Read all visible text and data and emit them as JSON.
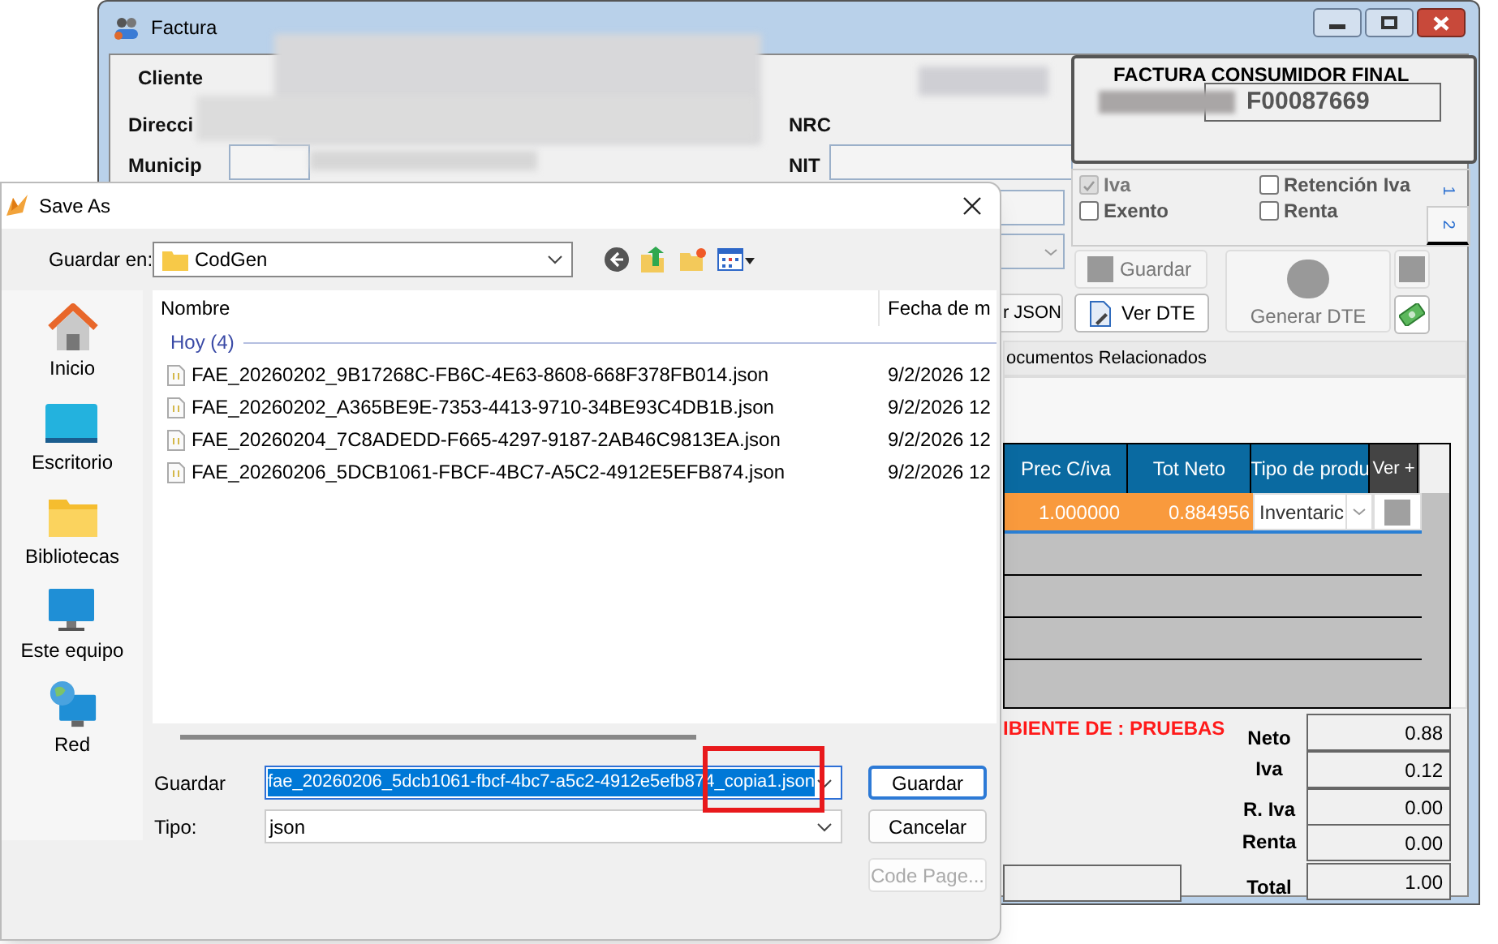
{
  "invoice_window": {
    "title": "Factura",
    "labels": [
      {
        "kind": "cliente",
        "text": "Cliente"
      },
      {
        "kind": "direccion",
        "text": "Direcci"
      },
      {
        "kind": "municipio",
        "text": "Municip"
      },
      {
        "kind": "nrc",
        "text": "NRC"
      },
      {
        "kind": "nit",
        "text": "NIT"
      }
    ],
    "document_panel": {
      "title": "FACTURA CONSUMIDOR FINAL",
      "number": "F00087669"
    },
    "checkboxes": [
      {
        "label": "Iva",
        "checked": true,
        "disabled": true
      },
      {
        "label": "Exento",
        "checked": false,
        "disabled": false
      },
      {
        "label": "Retención Iva",
        "checked": false,
        "disabled": false
      },
      {
        "label": "Renta",
        "checked": false,
        "disabled": false
      }
    ],
    "side_tabs": [
      {
        "label": "1",
        "selected": false
      },
      {
        "label": "2",
        "selected": true
      }
    ],
    "buttons": [
      {
        "kind": "json",
        "label": "r JSON",
        "disabled": false
      },
      {
        "kind": "guardar",
        "label": "Guardar",
        "disabled": true
      },
      {
        "kind": "ver",
        "label": "Ver DTE",
        "disabled": false
      },
      {
        "kind": "generar",
        "label": "Generar DTE",
        "disabled": true
      }
    ],
    "related_tab": "ocumentos Relacionados",
    "grid": {
      "columns": [
        "Prec C/iva",
        "Tot Neto",
        "Tipo de produ",
        "Ver +"
      ],
      "rows": [
        {
          "prec": "1.000000",
          "neto": "0.884956",
          "tipo": "Inventaric",
          "selected": true
        }
      ]
    },
    "environment_notice": "IBIENTE DE : PRUEBAS",
    "totals": [
      {
        "label": "Neto",
        "value": "0.88"
      },
      {
        "label": "Iva",
        "value": "0.12"
      },
      {
        "label": "R. Iva",
        "value": "0.00"
      },
      {
        "label": "Renta",
        "value": "0.00"
      },
      {
        "label": "Total",
        "value": "1.00"
      }
    ]
  },
  "save_dialog": {
    "title": "Save As",
    "location_label": "Guardar en:",
    "location": "CodGen",
    "places": [
      {
        "label": "Inicio"
      },
      {
        "label": "Escritorio"
      },
      {
        "label": "Bibliotecas"
      },
      {
        "label": "Este equipo"
      },
      {
        "label": "Red"
      }
    ],
    "columns": [
      "Nombre",
      "Fecha de m"
    ],
    "group": "Hoy (4)",
    "files": [
      {
        "name": "FAE_20260202_9B17268C-FB6C-4E63-8608-668F378FB014.json",
        "date": "9/2/2026 12"
      },
      {
        "name": "FAE_20260202_A365BE9E-7353-4413-9710-34BE93C4DB1B.json",
        "date": "9/2/2026 12"
      },
      {
        "name": "FAE_20260204_7C8ADEDD-F665-4297-9187-2AB46C9813EA.json",
        "date": "9/2/2026 12"
      },
      {
        "name": "FAE_20260206_5DCB1061-FBCF-4BC7-A5C2-4912E5EFB874.json",
        "date": "9/2/2026 12"
      }
    ],
    "filename_label": "Guardar",
    "filename": "fae_20260206_5dcb1061-fbcf-4bc7-a5c2-4912e5efb874_copia1.json",
    "filename_selected": true,
    "type_label": "Tipo:",
    "type": "json",
    "buttons": [
      {
        "label": "Guardar",
        "default": true,
        "disabled": false
      },
      {
        "label": "Cancelar",
        "default": false,
        "disabled": false
      },
      {
        "label": "Code Page...",
        "default": false,
        "disabled": true
      }
    ],
    "highlight_box": true
  }
}
